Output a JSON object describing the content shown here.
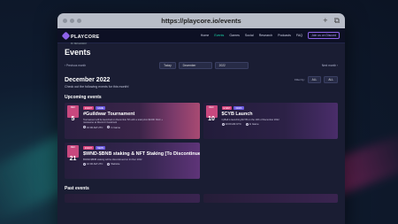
{
  "browser": {
    "url": "https://playcore.io/events"
  },
  "nav": {
    "logo": "PLAYCORE",
    "logo_sub": "BY BROADWAY",
    "links": [
      "Home",
      "Events",
      "Games",
      "Social",
      "Research",
      "Podcasts",
      "FAQ"
    ],
    "active": "Events",
    "join_button": "Join us on Discord"
  },
  "page": {
    "title": "Events",
    "prev_month": "‹ Previous month",
    "next_month": "Next month ›",
    "today_btn": "Today",
    "month_select": "December",
    "year_select": "2022",
    "month_heading": "December 2022",
    "subtitle": "Check out the following events for this month!",
    "filter_label": "Filter by:",
    "filter_a": "ALL",
    "filter_b": "ALL",
    "upcoming_title": "Upcoming events",
    "past_title": "Past events"
  },
  "events": [
    {
      "month": "DEC",
      "day": "5",
      "badge1": "EVENT",
      "badge2": "GAME",
      "title": "#Guildwar Tournament",
      "desc": "Tournament will be launched on December 5th with a total prize $100K NGC + metaverse at Discord / Facebook",
      "time": "10:00 AM UTC",
      "location": "In Game"
    },
    {
      "month": "DEC",
      "day": "10",
      "badge1": "EVENT",
      "badge2": "NEWS",
      "title": "$CYB Launch",
      "desc": "CyBall is launching $CYB on the 10th of December 2022",
      "time": "10:00 AM UTC",
      "location": "In Game"
    },
    {
      "month": "DEC",
      "day": "21",
      "badge1": "EVENT",
      "badge2": "NEWS",
      "title": "$WND-$BNB staking & NFT Staking [To Discontinue]",
      "desc": "$WND-$BNB staking will be discontinued on 21 Dec 2022",
      "time": "10:00 AM UTC",
      "location": "Website"
    }
  ]
}
